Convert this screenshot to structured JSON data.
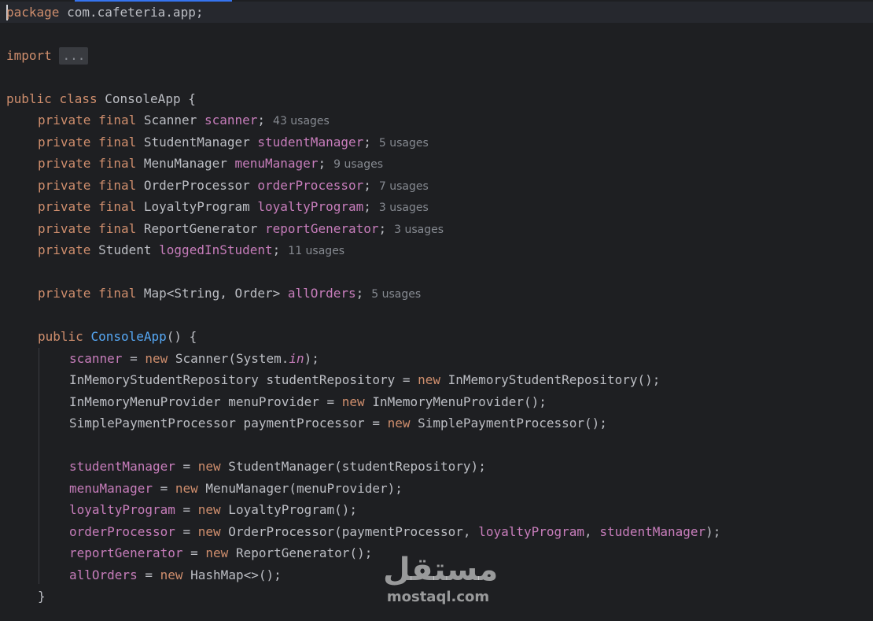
{
  "editor": {
    "package_kw": "package",
    "package_name": " com.cafeteria.app;",
    "import_kw": "import",
    "import_fold": "...",
    "class_kw1": "public",
    "class_kw2": "class",
    "class_name": "ConsoleApp",
    "open_brace": " {",
    "fields": [
      {
        "mods": "private final",
        "type": "Scanner",
        "name": "scanner",
        "usages": "43 usages"
      },
      {
        "mods": "private final",
        "type": "StudentManager",
        "name": "studentManager",
        "usages": "5 usages"
      },
      {
        "mods": "private final",
        "type": "MenuManager",
        "name": "menuManager",
        "usages": "9 usages"
      },
      {
        "mods": "private final",
        "type": "OrderProcessor",
        "name": "orderProcessor",
        "usages": "7 usages"
      },
      {
        "mods": "private final",
        "type": "LoyaltyProgram",
        "name": "loyaltyProgram",
        "usages": "3 usages"
      },
      {
        "mods": "private final",
        "type": "ReportGenerator",
        "name": "reportGenerator",
        "usages": "3 usages"
      },
      {
        "mods": "private",
        "type": "Student",
        "name": "loggedInStudent",
        "usages": "11 usages"
      },
      {
        "mods": "private final",
        "type": "Map<String, Order>",
        "name": "allOrders",
        "usages": "5 usages"
      }
    ],
    "ctor": {
      "mod": "public",
      "name": "ConsoleApp",
      "tail": "() {"
    },
    "body": [
      {
        "a": "scanner",
        "b": " = ",
        "k": "new",
        "c": " Scanner(System.",
        "i": "in",
        "d": ");"
      },
      {
        "t": "InMemoryStudentRepository studentRepository = ",
        "k": "new",
        "c": " InMemoryStudentRepository();"
      },
      {
        "t": "InMemoryMenuProvider menuProvider = ",
        "k": "new",
        "c": " InMemoryMenuProvider();"
      },
      {
        "t": "SimplePaymentProcessor paymentProcessor = ",
        "k": "new",
        "c": " SimplePaymentProcessor();"
      },
      {
        "a": "studentManager",
        "b": " = ",
        "k": "new",
        "c": " StudentManager(studentRepository);"
      },
      {
        "a": "menuManager",
        "b": " = ",
        "k": "new",
        "c": " MenuManager(menuProvider);"
      },
      {
        "a": "loyaltyProgram",
        "b": " = ",
        "k": "new",
        "c": " LoyaltyProgram();"
      },
      {
        "a": "orderProcessor",
        "b": " = ",
        "k": "new",
        "c": " OrderProcessor(paymentProcessor, ",
        "f1": "loyaltyProgram",
        "c2": ", ",
        "f2": "studentManager",
        "c3": ");"
      },
      {
        "a": "reportGenerator",
        "b": " = ",
        "k": "new",
        "c": " ReportGenerator();"
      },
      {
        "a": "allOrders",
        "b": " = ",
        "k": "new",
        "c": " HashMap<>();"
      }
    ],
    "close_brace": "}"
  },
  "watermark": {
    "logo": "مستقل",
    "url": "mostaql.com"
  },
  "colors": {
    "background": "#1e1f22",
    "keyword": "#cf8e6d",
    "field": "#c77dbb",
    "method": "#56a8f5",
    "text": "#bcbec4",
    "hint": "#868a91"
  }
}
